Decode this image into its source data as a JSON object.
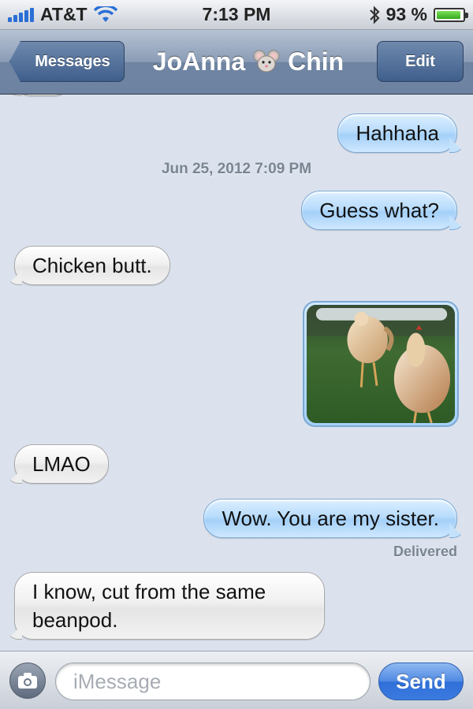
{
  "status_bar": {
    "carrier": "AT&T",
    "time": "7:13 PM",
    "battery_percent_label": "93 %",
    "battery_level": 0.93
  },
  "nav_bar": {
    "back_label": "Messages",
    "contact_first": "JoAnna",
    "contact_last": "Chin",
    "contact_emoji_icon": "mouse-face-icon",
    "edit_label": "Edit"
  },
  "messages": [
    {
      "direction": "outgoing",
      "text": "Hahhaha"
    },
    {
      "type": "timestamp",
      "text": "Jun 25, 2012 7:09 PM"
    },
    {
      "direction": "outgoing",
      "text": "Guess what?"
    },
    {
      "direction": "incoming",
      "text": "Chicken butt."
    },
    {
      "direction": "outgoing",
      "type": "photo",
      "icon": "chicken-photo"
    },
    {
      "direction": "incoming",
      "text": "LMAO"
    },
    {
      "direction": "outgoing",
      "text": "Wow.  You are my sister.",
      "status": "Delivered"
    },
    {
      "direction": "incoming",
      "text": "I know, cut from the same beanpod."
    }
  ],
  "compose": {
    "placeholder": "iMessage",
    "value": "",
    "send_label": "Send",
    "camera_icon": "camera-icon"
  },
  "colors": {
    "outgoing_bubble": "#b9dcfc",
    "incoming_bubble": "#eeeeee",
    "background": "#dbe2ed",
    "send_button": "#3b7be0"
  }
}
